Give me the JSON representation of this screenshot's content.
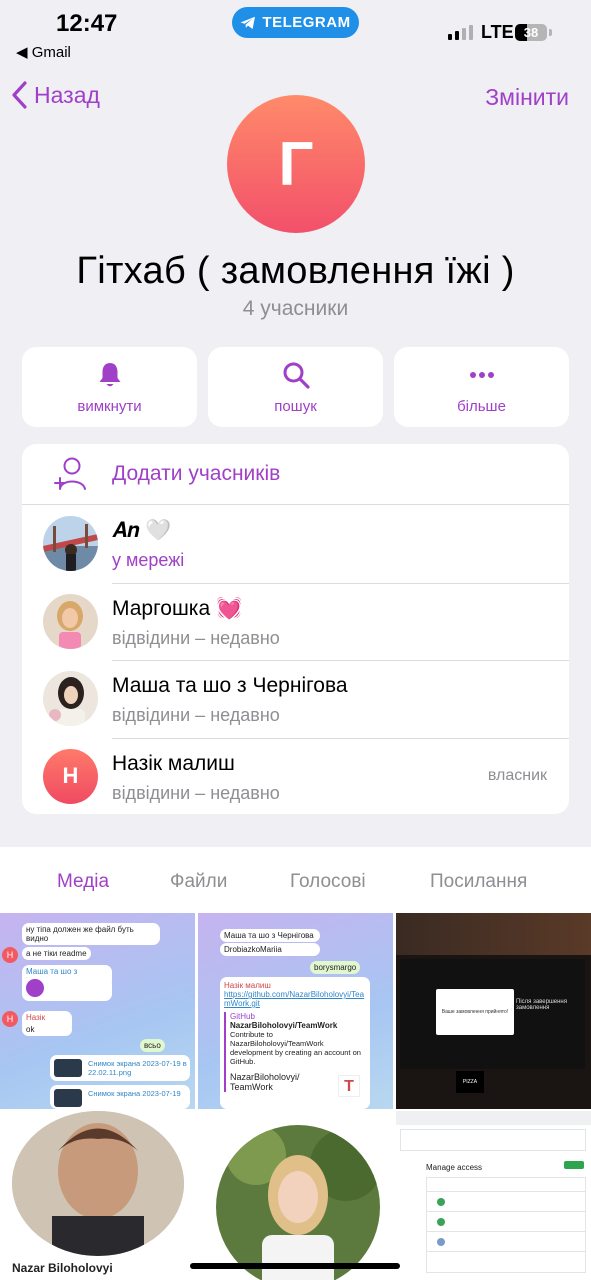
{
  "status_bar": {
    "time": "12:47",
    "back_app": "◀ Gmail",
    "pill_label": "TELEGRAM",
    "network": "LTE",
    "battery": "38"
  },
  "nav": {
    "back_label": "Назад",
    "edit_label": "Змінити"
  },
  "group": {
    "avatar_letter": "Г",
    "title": "Гітхаб ( замовлення їжі )",
    "subtitle": "4 учасники"
  },
  "actions": [
    {
      "label": "вимкнути",
      "icon": "bell-icon"
    },
    {
      "label": "пошук",
      "icon": "search-icon"
    },
    {
      "label": "більше",
      "icon": "more-icon"
    }
  ],
  "members": {
    "add_label": "Додати учасників",
    "list": [
      {
        "name": "𝑨𝒏 🤍",
        "status": "у мережі",
        "role": ""
      },
      {
        "name": "Маргошка 💓",
        "status": "відвідини – недавно",
        "role": ""
      },
      {
        "name": "Маша та шо з Чернігова",
        "status": "відвідини – недавно",
        "role": ""
      },
      {
        "name": "Назік малиш",
        "status": "відвідини – недавно",
        "role": "власник",
        "avatar_letter": "Н"
      }
    ]
  },
  "tabs": [
    "Медіа",
    "Файли",
    "Голосові",
    "Посилання"
  ],
  "media": {
    "tile1": {
      "lines": [
        "ну тіпа должен же файл буть видно",
        "а не тіки readme",
        "Маша та шо з Чернігова",
        "Назік малиш",
        "ok",
        "всьо",
        "Снимок экрана 2023-07-19 в 22.02.11.png",
        "Снимок экрана 2023-07-19"
      ]
    },
    "tile2": {
      "lines": [
        "Маша та шо з Чернігова",
        "DrobiazkoMariia",
        "borysmargo",
        "Назік малиш",
        "https://github.com/NazarBiloholovyi/TeamWork.git",
        "GitHub",
        "NazarBiloholovyi/TeamWork",
        "Contribute to NazarBiloholovyi/TeamWork development by creating an account on GitHub.",
        "NazarBiloholovyi/ TeamWork"
      ]
    },
    "tile3": {
      "lines": [
        "Ваше замовлення прийнято!",
        "Після завершення замовлення",
        "PIZZA"
      ]
    },
    "tile4": {
      "lines": [
        "Nazar Biloholovyi"
      ]
    },
    "tile6": {
      "lines": [
        "Manage access"
      ]
    }
  },
  "colors": {
    "accent": "#a040c8",
    "background": "#efeff4",
    "telegram": "#1f8fe8"
  }
}
